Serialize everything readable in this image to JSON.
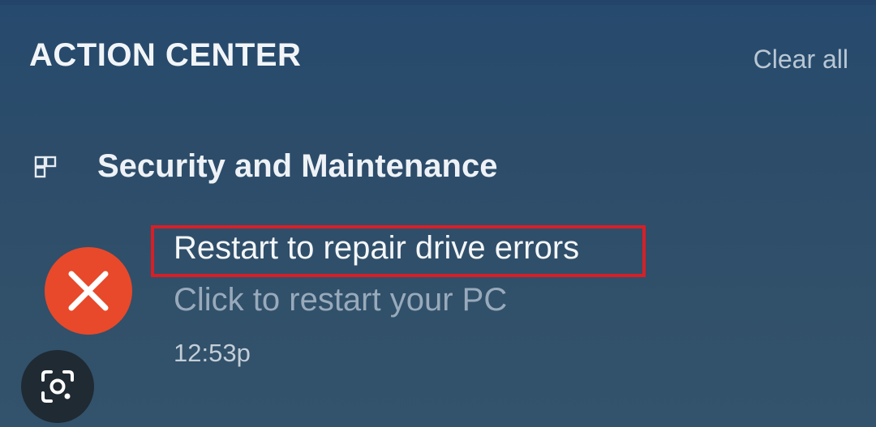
{
  "header": {
    "title": "ACTION CENTER",
    "clear_all_label": "Clear all"
  },
  "group": {
    "title": "Security and Maintenance",
    "icon": "app-tiles-icon"
  },
  "notification": {
    "icon": "error-x-icon",
    "title": "Restart to repair drive errors",
    "body": "Click to restart your PC",
    "time": "12:53p",
    "highlighted": true
  },
  "overlay": {
    "icon": "lens-search-icon"
  },
  "colors": {
    "background": "#2c4c6a",
    "error_icon": "#e8492a",
    "highlight_border": "#d81f26",
    "secondary_text": "#98aabb"
  }
}
